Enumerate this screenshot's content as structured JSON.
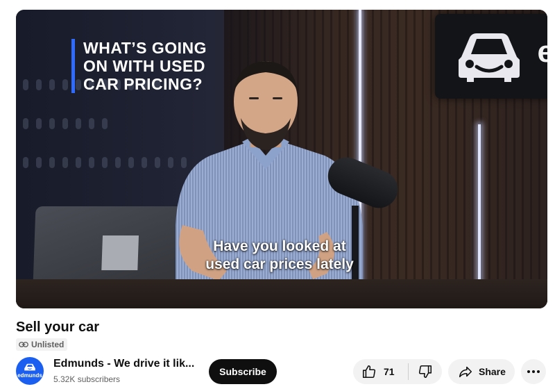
{
  "video": {
    "overlay_title_lines": [
      "WHAT’S GOING",
      "ON WITH USED",
      "CAR PRICING?"
    ],
    "caption_lines": [
      "Have you looked at",
      "used car prices lately"
    ],
    "accent_color": "#2f6bff",
    "logo_icon": "smiling-car-icon",
    "logo_letter": "e"
  },
  "title": "Sell your car",
  "visibility": {
    "icon": "link-icon",
    "label": "Unlisted"
  },
  "channel": {
    "avatar_icon": "edmunds-car-logo-icon",
    "avatar_text": "edmunds",
    "avatar_color": "#1a5ff0",
    "name": "Edmunds - We drive it lik...",
    "subscribers": "5.32K subscribers"
  },
  "actions": {
    "subscribe_label": "Subscribe",
    "like_icon": "thumbs-up-icon",
    "like_count": "71",
    "dislike_icon": "thumbs-down-icon",
    "share_icon": "share-arrow-icon",
    "share_label": "Share",
    "more_icon": "more-horizontal-icon"
  }
}
